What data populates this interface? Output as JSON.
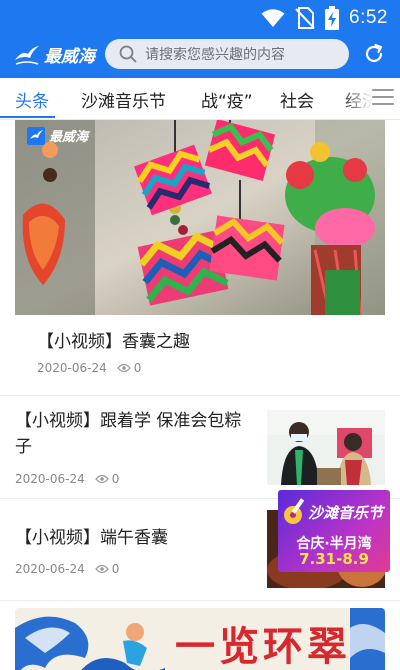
{
  "status_bar": {
    "time": "6:52",
    "icons": [
      "wifi-icon",
      "no-sim-icon",
      "battery-charging-icon"
    ]
  },
  "header": {
    "logo_text": "最威海",
    "search_placeholder": "请搜索您感兴趣的内容",
    "icons": [
      "seagull-logo-icon",
      "search-icon",
      "refresh-icon"
    ]
  },
  "tabs": [
    {
      "label": "头条",
      "active": true
    },
    {
      "label": "沙滩音乐节",
      "active": false
    },
    {
      "label": "战“疫”",
      "active": false
    },
    {
      "label": "社会",
      "active": false
    },
    {
      "label": "经济",
      "active": false
    }
  ],
  "colors": {
    "brand_blue": "#1e78f0",
    "search_bg": "#e7eaf0",
    "meta_gray": "#888888"
  },
  "feed": {
    "featured": {
      "title": "【小视频】香囊之趣",
      "date": "2020-06-24",
      "views": "0",
      "image_watermark": "最威海"
    },
    "items": [
      {
        "title": "【小视频】跟着学 保准会包粽子",
        "date": "2020-06-24",
        "views": "0"
      },
      {
        "title": "【小视频】端午香囊",
        "date": "2020-06-24",
        "views": "0"
      }
    ],
    "floating_ad": {
      "title": "沙滩音乐节",
      "location": "合庆·半月湾",
      "dates": "7.31-8.9"
    },
    "banner": {
      "text": "一览环翠"
    }
  }
}
